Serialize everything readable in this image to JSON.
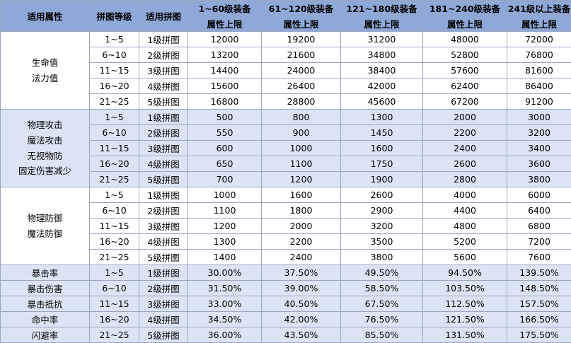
{
  "header": {
    "attr": "适用属性",
    "level": "拼图等级",
    "puzzle": "适用拼图",
    "tiers": [
      "1~60级装备",
      "61~120级装备",
      "121~180级装备",
      "181~240级装备",
      "241级以上装备"
    ],
    "tier_sub": "属性上限"
  },
  "groups": [
    {
      "attrs": [
        "生命值",
        "法力值"
      ],
      "rows": [
        {
          "level": "1~5",
          "puzzle": "1级拼图",
          "v": [
            "12000",
            "19200",
            "31200",
            "48000",
            "72000"
          ]
        },
        {
          "level": "6~10",
          "puzzle": "2级拼图",
          "v": [
            "13200",
            "21600",
            "34800",
            "52800",
            "76800"
          ]
        },
        {
          "level": "11~15",
          "puzzle": "3级拼图",
          "v": [
            "14400",
            "24000",
            "38400",
            "57600",
            "81600"
          ]
        },
        {
          "level": "16~20",
          "puzzle": "4级拼图",
          "v": [
            "15600",
            "26400",
            "42000",
            "62400",
            "86400"
          ]
        },
        {
          "level": "21~25",
          "puzzle": "5级拼图",
          "v": [
            "16800",
            "28800",
            "45600",
            "67200",
            "91200"
          ]
        }
      ]
    },
    {
      "attrs": [
        "物理攻击",
        "魔法攻击",
        "无视物防",
        "固定伤害减少"
      ],
      "rows": [
        {
          "level": "1~5",
          "puzzle": "1级拼图",
          "v": [
            "500",
            "800",
            "1300",
            "2000",
            "3000"
          ]
        },
        {
          "level": "6~10",
          "puzzle": "2级拼图",
          "v": [
            "550",
            "900",
            "1450",
            "2200",
            "3200"
          ]
        },
        {
          "level": "11~15",
          "puzzle": "3级拼图",
          "v": [
            "600",
            "1000",
            "1600",
            "2400",
            "3400"
          ]
        },
        {
          "level": "16~20",
          "puzzle": "4级拼图",
          "v": [
            "650",
            "1100",
            "1750",
            "2600",
            "3600"
          ]
        },
        {
          "level": "21~25",
          "puzzle": "5级拼图",
          "v": [
            "700",
            "1200",
            "1900",
            "2800",
            "3800"
          ]
        }
      ]
    },
    {
      "attrs": [
        "物理防御",
        "魔法防御"
      ],
      "rows": [
        {
          "level": "1~5",
          "puzzle": "1级拼图",
          "v": [
            "1000",
            "1600",
            "2600",
            "4000",
            "6000"
          ]
        },
        {
          "level": "6~10",
          "puzzle": "2级拼图",
          "v": [
            "1100",
            "1800",
            "2900",
            "4400",
            "6400"
          ]
        },
        {
          "level": "11~15",
          "puzzle": "3级拼图",
          "v": [
            "1200",
            "2000",
            "3200",
            "4800",
            "6800"
          ]
        },
        {
          "level": "16~20",
          "puzzle": "4级拼图",
          "v": [
            "1300",
            "2200",
            "3500",
            "5200",
            "7200"
          ]
        },
        {
          "level": "21~25",
          "puzzle": "5级拼图",
          "v": [
            "1400",
            "2400",
            "3800",
            "5600",
            "7600"
          ]
        }
      ]
    },
    {
      "attrs_per_row": [
        "暴击率",
        "暴击伤害",
        "暴击抵抗",
        "命中率",
        "闪避率"
      ],
      "rows": [
        {
          "level": "1~5",
          "puzzle": "1级拼图",
          "v": [
            "30.00%",
            "37.50%",
            "49.50%",
            "94.50%",
            "139.50%"
          ]
        },
        {
          "level": "6~10",
          "puzzle": "2级拼图",
          "v": [
            "31.50%",
            "39.00%",
            "58.50%",
            "103.50%",
            "148.50%"
          ]
        },
        {
          "level": "11~15",
          "puzzle": "3级拼图",
          "v": [
            "33.00%",
            "40.50%",
            "67.50%",
            "112.50%",
            "157.50%"
          ]
        },
        {
          "level": "16~20",
          "puzzle": "4级拼图",
          "v": [
            "34.50%",
            "42.00%",
            "76.50%",
            "121.50%",
            "166.50%"
          ]
        },
        {
          "level": "21~25",
          "puzzle": "5级拼图",
          "v": [
            "36.00%",
            "43.50%",
            "85.50%",
            "131.50%",
            "175.50%"
          ]
        }
      ]
    }
  ]
}
